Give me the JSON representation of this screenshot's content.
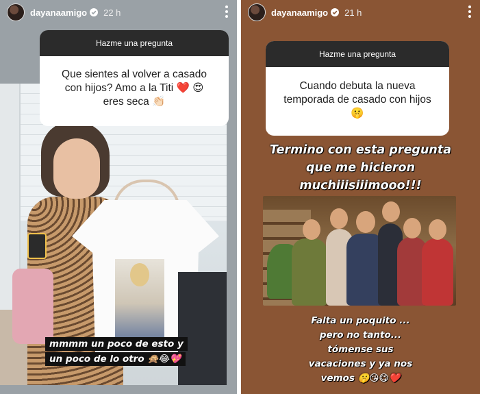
{
  "left_story": {
    "username": "dayanaamigo",
    "time": "22 h",
    "question_header": "Hazme una pregunta",
    "question_lines": [
      "Que sientes al volver a casado",
      "con hijos? Amo a la Titi ❤️ 😍",
      "eres seca 👏🏻"
    ],
    "caption_lines": [
      "mmmm un poco de esto y",
      "un poco de lo otro 🙊😂💖"
    ]
  },
  "right_story": {
    "username": "dayanaamigo",
    "time": "21 h",
    "question_header": "Hazme una pregunta",
    "question_lines": [
      "Cuando debuta la nueva",
      "temporada de casado con hijos",
      "🤫"
    ],
    "title_lines": [
      "Termino con esta pregunta",
      "que me hicieron",
      "muchiiisiiimooo!!!"
    ],
    "caption_lines": [
      "Falta un poquito ...",
      "pero no tanto...",
      "tómense sus",
      "vacaciones y ya nos",
      "vemos 🤫😘😋❤️"
    ]
  },
  "colors": {
    "left_bg": "#9aa1a6",
    "right_bg": "#8a5534",
    "question_header_bg": "#2b2b2b",
    "verified_badge": "#ffffff"
  },
  "icons": [
    "avatar",
    "verified-badge-icon",
    "more-options-icon"
  ]
}
